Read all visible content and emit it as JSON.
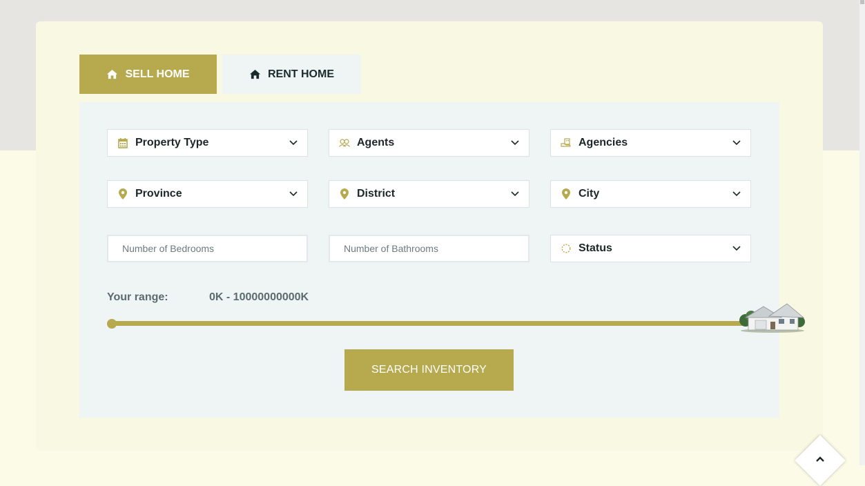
{
  "tabs": {
    "sell": {
      "label": "SELL HOME",
      "icon": "home-icon"
    },
    "rent": {
      "label": "RENT HOME",
      "icon": "home-icon"
    }
  },
  "filters": {
    "property_type": {
      "label": "Property Type",
      "icon": "calendar-icon"
    },
    "agents": {
      "label": "Agents",
      "icon": "users-icon"
    },
    "agencies": {
      "label": "Agencies",
      "icon": "building-hand-icon"
    },
    "province": {
      "label": "Province",
      "icon": "map-pin-icon"
    },
    "district": {
      "label": "District",
      "icon": "map-pin-icon"
    },
    "city": {
      "label": "City",
      "icon": "map-pin-icon"
    },
    "status": {
      "label": "Status",
      "icon": "spinner-icon"
    }
  },
  "inputs": {
    "bedrooms": {
      "placeholder": "Number of Bedrooms",
      "value": ""
    },
    "bathrooms": {
      "placeholder": "Number of Bathrooms",
      "value": ""
    }
  },
  "range": {
    "label": "Your range:",
    "value": "0K - 10000000000K",
    "min_fraction": 0,
    "max_fraction": 1
  },
  "search_button": {
    "label": "SEARCH INVENTORY"
  },
  "colors": {
    "accent": "#b7a94e",
    "panel": "#eff4f5",
    "card": "#f9f8e2",
    "text": "#1d2627"
  }
}
